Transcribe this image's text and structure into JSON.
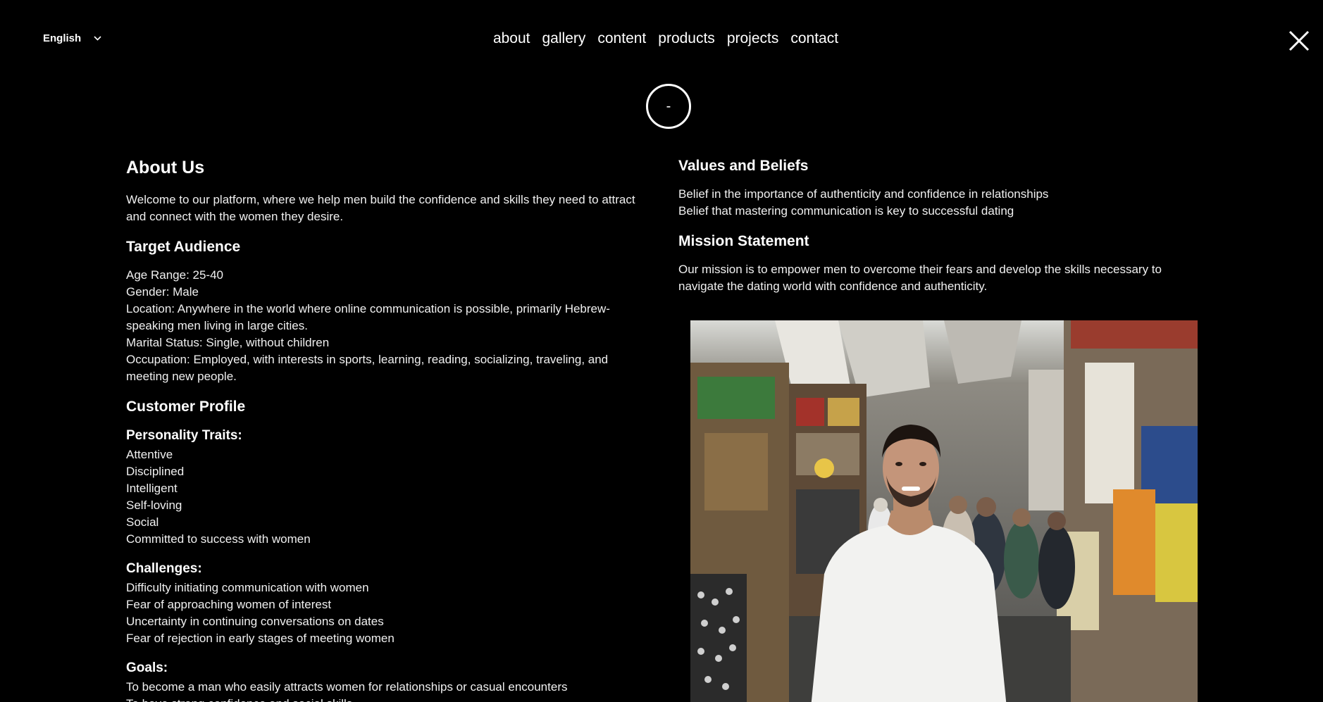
{
  "header": {
    "language": "English",
    "nav": [
      "about",
      "gallery",
      "content",
      "products",
      "projects",
      "contact"
    ],
    "logo_text": "-"
  },
  "about": {
    "title": "About Us",
    "intro": "Welcome to our platform, where we help men build the confidence and skills they need to attract and connect with the women they desire."
  },
  "target_audience": {
    "title": "Target Audience",
    "lines": [
      "Age Range: 25-40",
      "Gender: Male",
      "Location: Anywhere in the world where online communication is possible, primarily Hebrew-speaking men living in large cities.",
      "Marital Status: Single, without children",
      "Occupation: Employed, with interests in sports, learning, reading, socializing, traveling, and meeting new people."
    ]
  },
  "customer_profile": {
    "title": "Customer Profile",
    "personality": {
      "title": "Personality Traits:",
      "items": [
        "Attentive",
        "Disciplined",
        "Intelligent",
        "Self-loving",
        "Social",
        "Committed to success with women"
      ]
    },
    "challenges": {
      "title": "Challenges:",
      "items": [
        "Difficulty initiating communication with women",
        "Fear of approaching women of interest",
        "Uncertainty in continuing conversations on dates",
        "Fear of rejection in early stages of meeting women"
      ]
    },
    "goals": {
      "title": "Goals:",
      "items": [
        "To become a man who easily attracts women for relationships or casual encounters",
        "To have strong confidence and social skills"
      ]
    }
  },
  "values": {
    "title": "Values and Beliefs",
    "items": [
      "Belief in the importance of authenticity and confidence in relationships",
      "Belief that mastering communication is key to successful dating"
    ]
  },
  "mission": {
    "title": "Mission Statement",
    "text": "Our mission is to empower men to overcome their fears and develop the skills necessary to navigate the dating world with confidence and authenticity."
  },
  "colors": {
    "background": "#000000",
    "text": "#ffffff"
  }
}
